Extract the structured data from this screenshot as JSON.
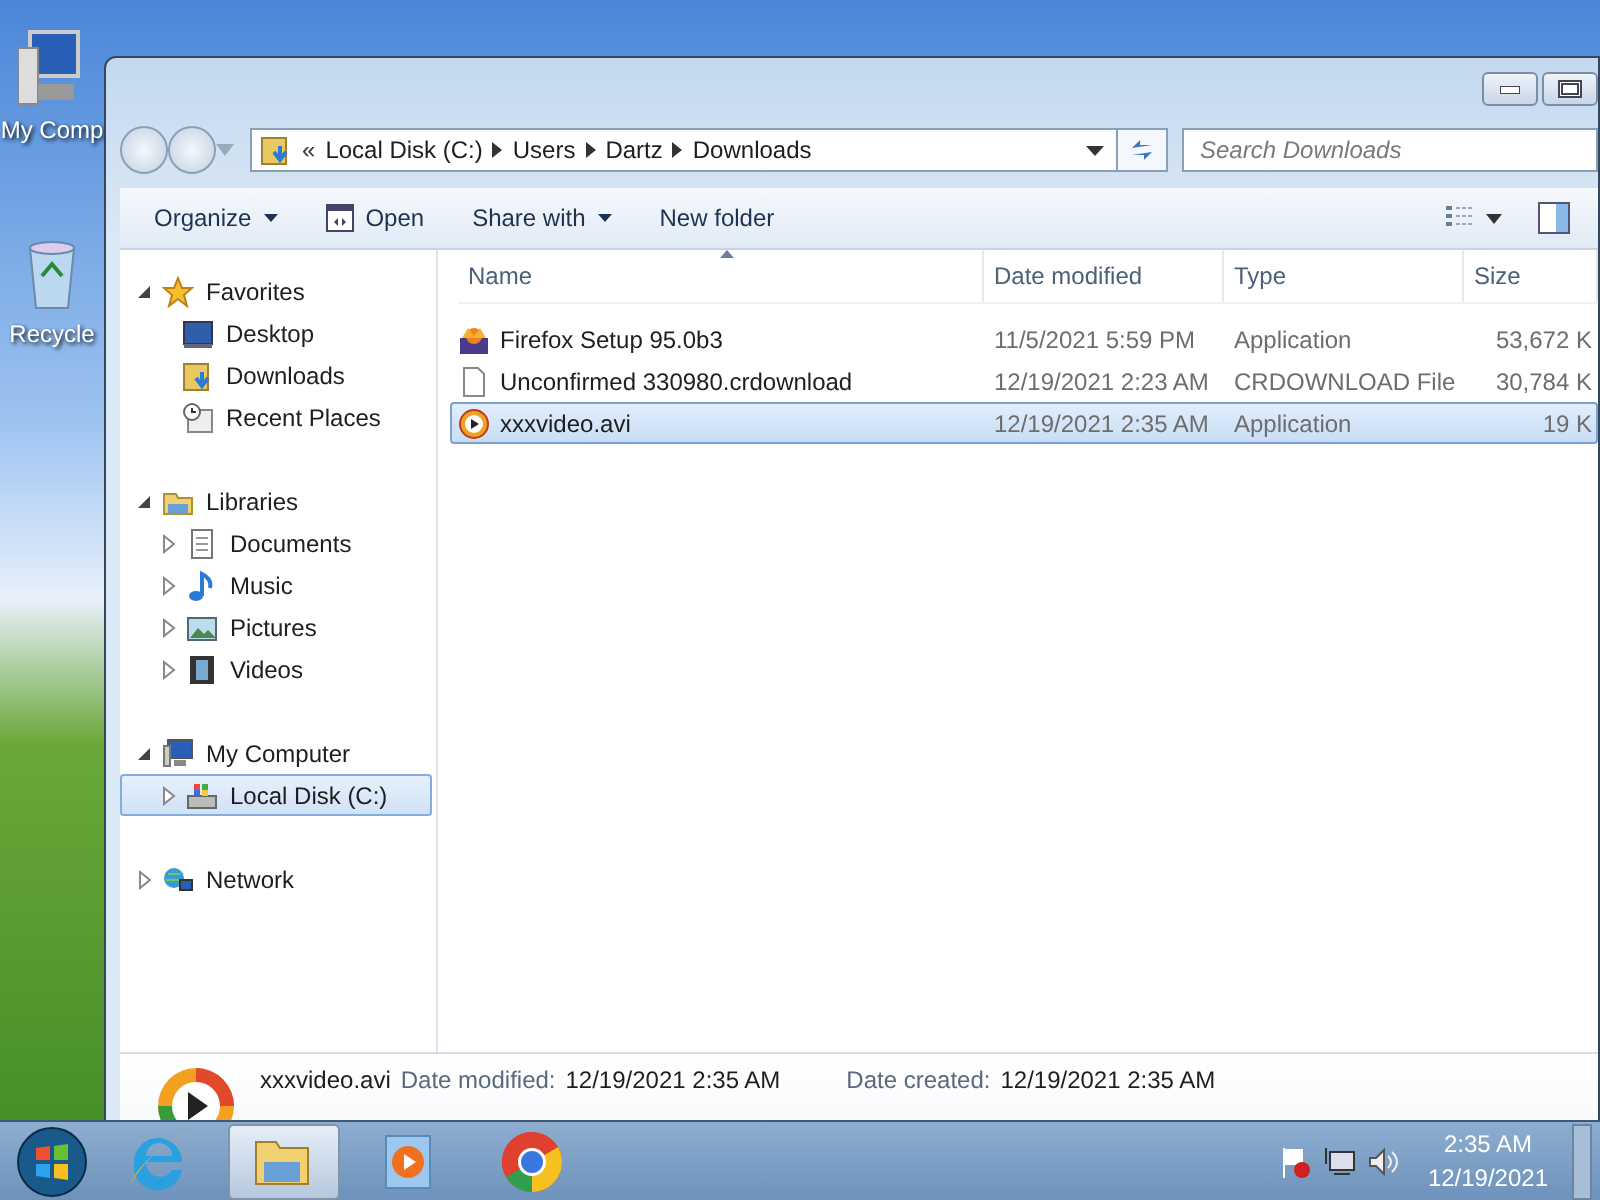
{
  "desktop_icons": [
    {
      "kind": "computer",
      "label": "My Comp"
    },
    {
      "kind": "recycle",
      "label": "Recycle"
    }
  ],
  "window": {
    "address": {
      "overflow": "«",
      "path": [
        "Local Disk (C:)",
        "Users",
        "Dartz",
        "Downloads"
      ]
    },
    "search": {
      "placeholder": "Search Downloads"
    },
    "toolbar": [
      {
        "kind": "menu",
        "label": "Organize"
      },
      {
        "kind": "open",
        "label": "Open"
      },
      {
        "kind": "menu",
        "label": "Share with"
      },
      {
        "kind": "plain",
        "label": "New folder"
      }
    ],
    "navigation": [
      {
        "kind": "favorites",
        "label": "Favorites",
        "expanded": true,
        "selected": false,
        "children": [
          {
            "kind": "desktop",
            "label": "Desktop",
            "selected": false
          },
          {
            "kind": "downloads",
            "label": "Downloads",
            "selected": false
          },
          {
            "kind": "recent",
            "label": "Recent Places",
            "selected": false
          }
        ]
      },
      {
        "kind": "libraries",
        "label": "Libraries",
        "expanded": true,
        "selected": false,
        "children": [
          {
            "kind": "documents",
            "label": "Documents",
            "expanded": false,
            "selected": false
          },
          {
            "kind": "music",
            "label": "Music",
            "expanded": false,
            "selected": false
          },
          {
            "kind": "pictures",
            "label": "Pictures",
            "expanded": false,
            "selected": false
          },
          {
            "kind": "videos",
            "label": "Videos",
            "expanded": false,
            "selected": false
          }
        ]
      },
      {
        "kind": "computer",
        "label": "My Computer",
        "expanded": true,
        "selected": false,
        "children": [
          {
            "kind": "disk",
            "label": "Local Disk (C:)",
            "expanded": false,
            "selected": true
          }
        ]
      },
      {
        "kind": "network",
        "label": "Network",
        "expanded": false,
        "selected": false
      }
    ],
    "columns": [
      {
        "label": "Name",
        "sorted": true
      },
      {
        "label": "Date modified",
        "sorted": false
      },
      {
        "label": "Type",
        "sorted": false
      },
      {
        "label": "Size",
        "sorted": false
      }
    ],
    "rows": [
      {
        "name": "Firefox Setup 95.0b3",
        "date": "11/5/2021 5:59 PM",
        "type": "Application",
        "size": "53,672 K",
        "selected": false
      },
      {
        "name": "Unconfirmed 330980.crdownload",
        "date": "12/19/2021 2:23 AM",
        "type": "CRDOWNLOAD File",
        "size": "30,784 K",
        "selected": false
      },
      {
        "name": "xxxvideo.avi",
        "date": "12/19/2021 2:35 AM",
        "type": "Application",
        "size": "19 K",
        "selected": true
      }
    ],
    "details": {
      "name": "xxxvideo.avi",
      "fields": [
        {
          "label": "Date modified:",
          "value": "12/19/2021 2:35 AM"
        },
        {
          "label": "Date created:",
          "value": "12/19/2021 2:35 AM"
        }
      ]
    }
  },
  "taskbar": {
    "apps": [
      {
        "kind": "ie",
        "active": false
      },
      {
        "kind": "explorer",
        "active": true
      },
      {
        "kind": "player",
        "active": false
      },
      {
        "kind": "chrome",
        "active": false
      }
    ],
    "tray": {
      "time": "2:35 AM",
      "date": "12/19/2021"
    }
  }
}
